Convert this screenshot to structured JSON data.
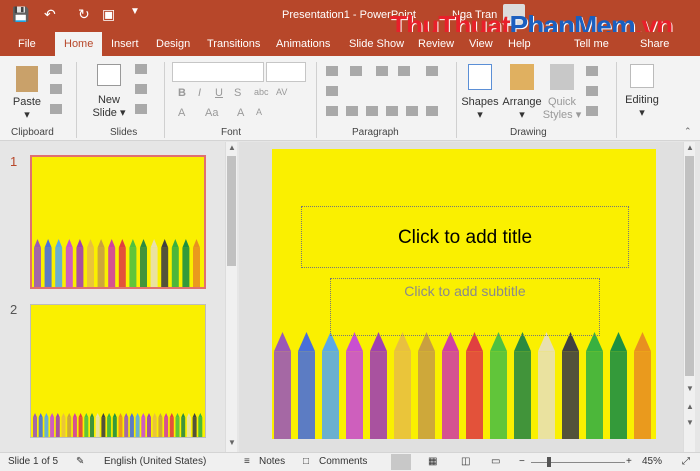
{
  "window": {
    "title": "Presentation1 - PowerPoint",
    "user": "Nga Tran"
  },
  "watermark": {
    "part1": "ThuThuat",
    "part2": "PhanMem",
    "part3": ".vn"
  },
  "tabs": [
    "File",
    "Home",
    "Insert",
    "Design",
    "Transitions",
    "Animations",
    "Slide Show",
    "Review",
    "View",
    "Help",
    "Tell me"
  ],
  "share_label": "Share",
  "ribbon": {
    "clipboard": {
      "label": "Clipboard",
      "paste": "Paste"
    },
    "slides": {
      "label": "Slides",
      "new_slide_line1": "New",
      "new_slide_line2": "Slide"
    },
    "font": {
      "label": "Font"
    },
    "paragraph": {
      "label": "Paragraph"
    },
    "drawing": {
      "label": "Drawing",
      "shapes": "Shapes",
      "arrange": "Arrange",
      "quick_styles_1": "Quick",
      "quick_styles_2": "Styles"
    },
    "editing": {
      "label": "Editing"
    }
  },
  "thumbnails": [
    {
      "number": "1"
    },
    {
      "number": "2"
    }
  ],
  "slide": {
    "title_placeholder": "Click to add title",
    "subtitle_placeholder": "Click to add subtitle"
  },
  "status": {
    "slide_count": "Slide 1 of 5",
    "language": "English (United States)",
    "notes": "Notes",
    "comments": "Comments",
    "zoom": "45%"
  },
  "colors": {
    "accent": "#b7472a",
    "slide_bg": "#faf000"
  }
}
